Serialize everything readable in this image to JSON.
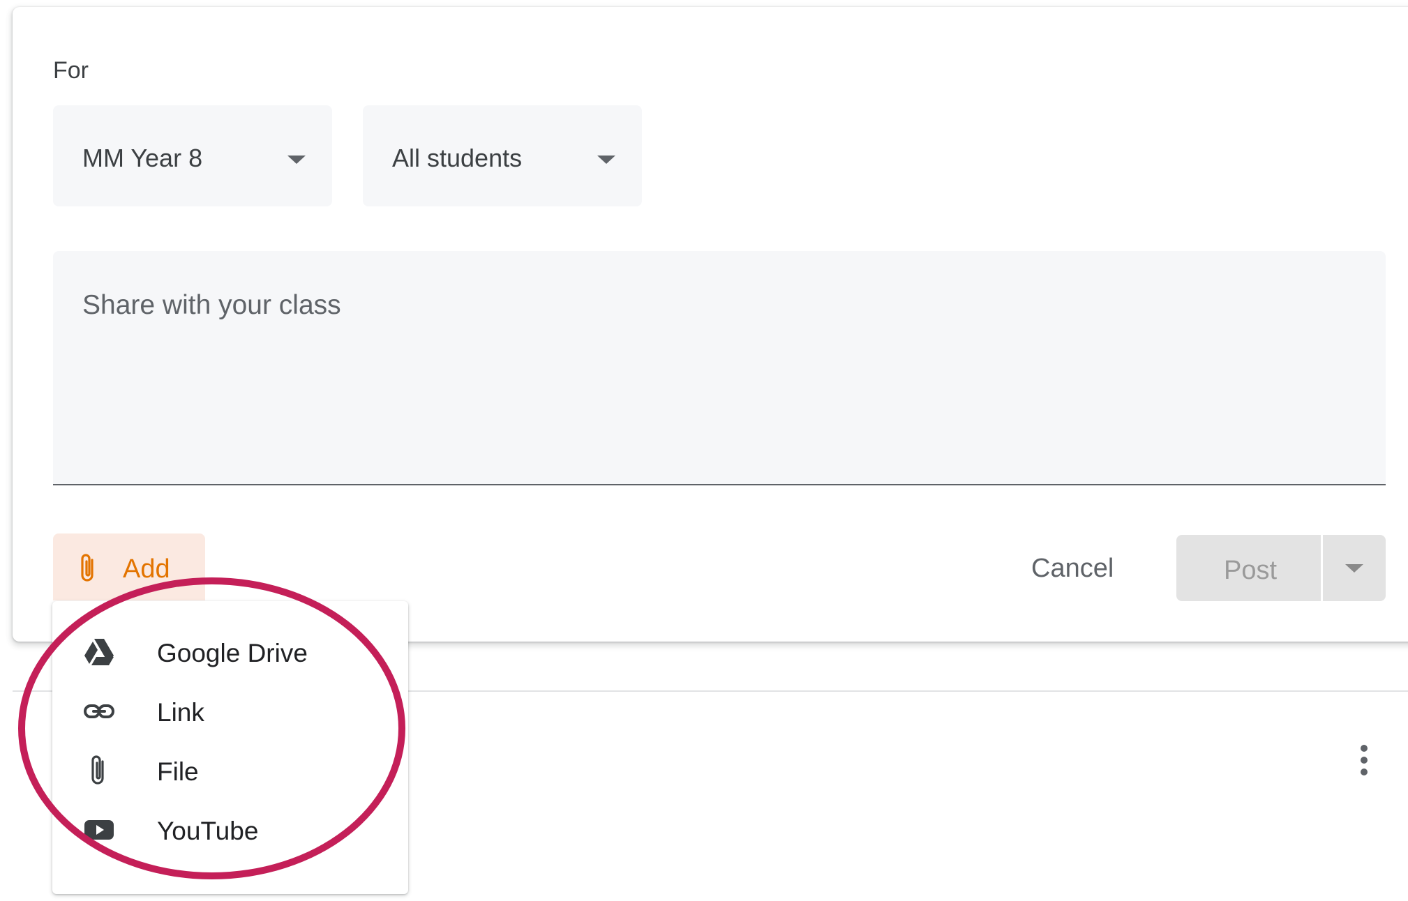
{
  "composer": {
    "for_label": "For",
    "class_select": "MM Year 8",
    "students_select": "All students",
    "share_placeholder": "Share with your class",
    "add_label": "Add",
    "cancel_label": "Cancel",
    "post_label": "Post"
  },
  "add_menu": {
    "items": [
      {
        "label": "Google Drive",
        "icon": "google-drive-icon"
      },
      {
        "label": "Link",
        "icon": "link-icon"
      },
      {
        "label": "File",
        "icon": "paperclip-icon"
      },
      {
        "label": "YouTube",
        "icon": "youtube-icon"
      }
    ]
  },
  "colors": {
    "accent": "#e37400",
    "add_bg": "#fbe9e1",
    "highlight": "#c41f58"
  }
}
